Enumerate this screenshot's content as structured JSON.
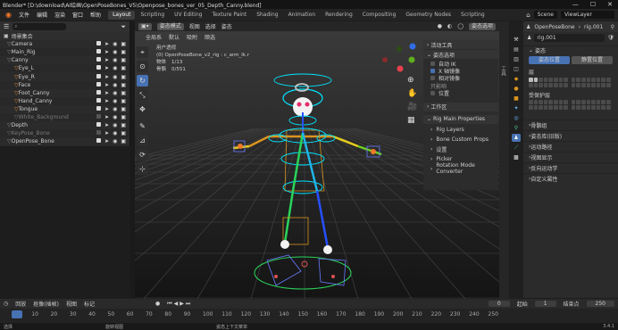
{
  "window": {
    "title": "Blender* [D:\\download\\AI绘画\\OpenPoseBones_V5\\Openpose_bones_ver_05_Depth_Canny.blend]",
    "min": "—",
    "max": "☐",
    "close": "✕"
  },
  "menus": [
    "文件",
    "编辑",
    "渲染",
    "窗口",
    "帮助"
  ],
  "workspaces": [
    "Layout",
    "Scripting",
    "UV Editing",
    "Texture Paint",
    "Shading",
    "Animation",
    "Rendering",
    "Compositing",
    "Geometry Nodes",
    "Scripting"
  ],
  "active_workspace": "Layout",
  "scene": {
    "name": "Scene",
    "view_layer": "ViewLayer"
  },
  "outliner": {
    "title": "场景集合",
    "rows": [
      {
        "name": "Camera",
        "indent": 1,
        "color": "#8a8a8a",
        "visible": true
      },
      {
        "name": "Main_Rig",
        "indent": 1,
        "color": "#8a8a8a",
        "visible": true
      },
      {
        "name": "Canny",
        "indent": 1,
        "color": "#8a8a8a",
        "visible": true
      },
      {
        "name": "Eye_L",
        "indent": 2,
        "color": "#d98a3a",
        "visible": true
      },
      {
        "name": "Eye_R",
        "indent": 2,
        "color": "#d98a3a",
        "visible": true
      },
      {
        "name": "Face",
        "indent": 2,
        "color": "#d98a3a",
        "visible": true
      },
      {
        "name": "Foot_Canny",
        "indent": 2,
        "color": "#d98a3a",
        "visible": true
      },
      {
        "name": "Hand_Canny",
        "indent": 2,
        "color": "#d98a3a",
        "visible": true
      },
      {
        "name": "Tongue",
        "indent": 2,
        "color": "#d98a3a",
        "visible": true
      },
      {
        "name": "White_Background",
        "indent": 2,
        "color": "#777",
        "visible": false
      },
      {
        "name": "Depth",
        "indent": 1,
        "color": "#8a8a8a",
        "visible": true
      },
      {
        "name": "KeyPose_Bone",
        "indent": 1,
        "color": "#777",
        "visible": false
      },
      {
        "name": "OpenPose_Bone",
        "indent": 1,
        "color": "#8a8a8a",
        "visible": true
      }
    ]
  },
  "viewport": {
    "mode": "姿态模式",
    "view": "视图",
    "select": "选择",
    "pose": "姿态",
    "global": "全局系",
    "default": "默认",
    "snap": "吸附",
    "sel_label": "顺选",
    "info_title": "用户透视",
    "info_obj": "(0) OpenPoseBone_v2_rig : c_arm_lk.r",
    "info_objects_label": "物体",
    "info_objects": "1/13",
    "info_bones_label": "骨骼",
    "info_bones": "0/551",
    "overlay_btn": "姿态选项"
  },
  "npanel": {
    "header1": "活动工具",
    "header2": "姿态选项",
    "opt1": "自动 IK",
    "opt2": "X 轴镜像",
    "opt3": "相对镜像",
    "opt4_label": "只影响",
    "opt5": "位置",
    "header3": "工作区",
    "rig_header": "Rig Main Properties",
    "rig_items": [
      "Rig Layers",
      "Bone Custom Props",
      "设置",
      "Picker",
      "Rotation Mode Converter"
    ]
  },
  "props": {
    "object": "OpenPoseBone",
    "rig": "rig.001",
    "sel_name": "rig.001",
    "sec_pose": "姿态",
    "btn_pose_pos": "姿态位置",
    "btn_rest_pos": "静置位置",
    "label_layers": "层",
    "label_protected": "受保护层",
    "sections": [
      "骨骼组",
      "姿态库(旧版)",
      "运动路径",
      "视图显示",
      "反向运动学",
      "自定义属性"
    ]
  },
  "timeline": {
    "playback": "回放",
    "keying": "抠像(插帧)",
    "view": "视图",
    "marker": "标记",
    "current": "0",
    "start_label": "起始",
    "start": "1",
    "end_label": "结束点",
    "end": "250",
    "ticks": [
      "0",
      "10",
      "20",
      "30",
      "40",
      "50",
      "60",
      "70",
      "80",
      "90",
      "100",
      "110",
      "120",
      "130",
      "140",
      "150",
      "160",
      "170",
      "180",
      "190",
      "200",
      "210",
      "220",
      "230",
      "240",
      "250"
    ]
  },
  "status": {
    "s1": "选择",
    "s2": "旋转视图",
    "s3": "姿态上下文菜单",
    "version": "3.4.1"
  },
  "colors": {
    "accent": "#4772b3",
    "bone_cyan": "#00e5ff",
    "bone_green": "#29d35a",
    "bone_orange": "#d9941f"
  }
}
